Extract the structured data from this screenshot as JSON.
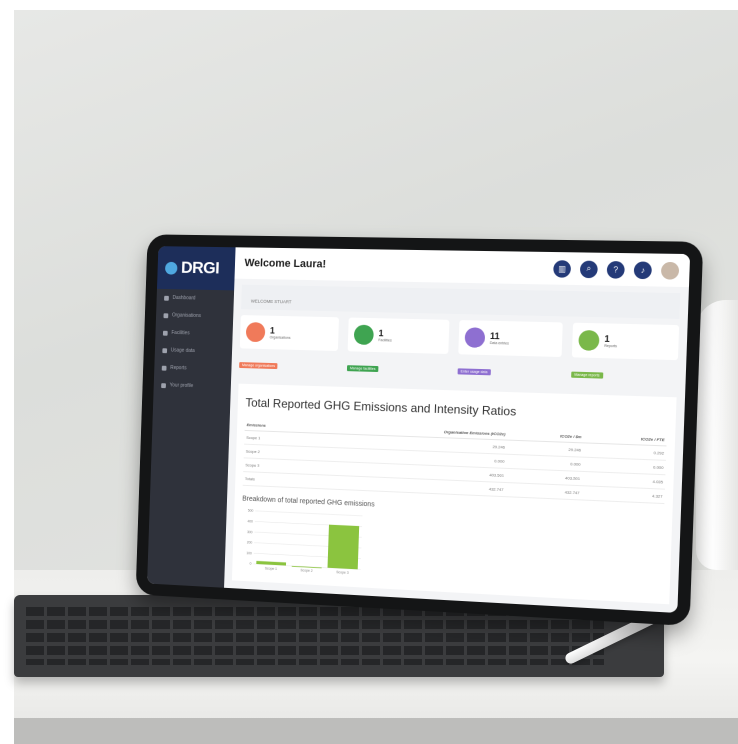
{
  "colors": {
    "sidebar": "#2f323b",
    "brand": "#1d2e5a",
    "icon_bg": "#243a78",
    "orange": "#f07a5a",
    "green": "#3fa451",
    "purple": "#8e6fd1",
    "lime": "#7ab84a",
    "bar": "#8bc43f"
  },
  "logo": {
    "text": "DRGI"
  },
  "sidebar": {
    "items": [
      {
        "icon": "dashboard-icon",
        "label": "Dashboard"
      },
      {
        "icon": "organisation-icon",
        "label": "Organisations"
      },
      {
        "icon": "facility-icon",
        "label": "Facilities"
      },
      {
        "icon": "usage-icon",
        "label": "Usage data"
      },
      {
        "icon": "report-icon",
        "label": "Reports"
      },
      {
        "icon": "profile-icon",
        "label": "Your profile"
      }
    ]
  },
  "header": {
    "welcome": "Welcome Laura!",
    "icons": [
      "chart-icon",
      "search-icon",
      "help-icon",
      "bell-icon",
      "avatar"
    ]
  },
  "greeting": "WELCOME STUART",
  "cards": [
    {
      "num": "1",
      "label": "Organisations",
      "icon": "building-icon",
      "color": "#f07a5a",
      "tag": "Manage organisations",
      "tag_color": "#f07a5a"
    },
    {
      "num": "1",
      "label": "Facilities",
      "icon": "pin-icon",
      "color": "#3fa451",
      "tag": "Manage facilities",
      "tag_color": "#3fa451"
    },
    {
      "num": "11",
      "label": "Data entries",
      "icon": "chart-icon",
      "color": "#8e6fd1",
      "tag": "Enter usage data",
      "tag_color": "#8e6fd1"
    },
    {
      "num": "1",
      "label": "Reports",
      "icon": "document-icon",
      "color": "#7ab84a",
      "tag": "Manage reports",
      "tag_color": "#7ab84a"
    }
  ],
  "panel": {
    "title": "Total Reported GHG Emissions and Intensity Ratios",
    "subtitle": "Breakdown of total reported GHG emissions"
  },
  "table": {
    "headers": [
      "Emissions",
      "Organisation Emissions (tCO2e)",
      "tCO2e / $m",
      "tCO2e / FTE"
    ],
    "rows": [
      [
        "Scope 1",
        "29.246",
        "29.246",
        "0.292"
      ],
      [
        "Scope 2",
        "0.000",
        "0.000",
        "0.000"
      ],
      [
        "Scope 3",
        "403.501",
        "403.501",
        "4.035"
      ],
      [
        "Totals",
        "432.747",
        "432.747",
        "4.327"
      ]
    ]
  },
  "chart_data": {
    "type": "bar",
    "categories": [
      "Scope 1",
      "Scope 2",
      "Scope 3"
    ],
    "values": [
      29.246,
      0.0,
      403.501
    ],
    "ylim": [
      0,
      500
    ],
    "yticks": [
      0,
      100,
      200,
      300,
      400,
      500
    ],
    "grid": true
  }
}
